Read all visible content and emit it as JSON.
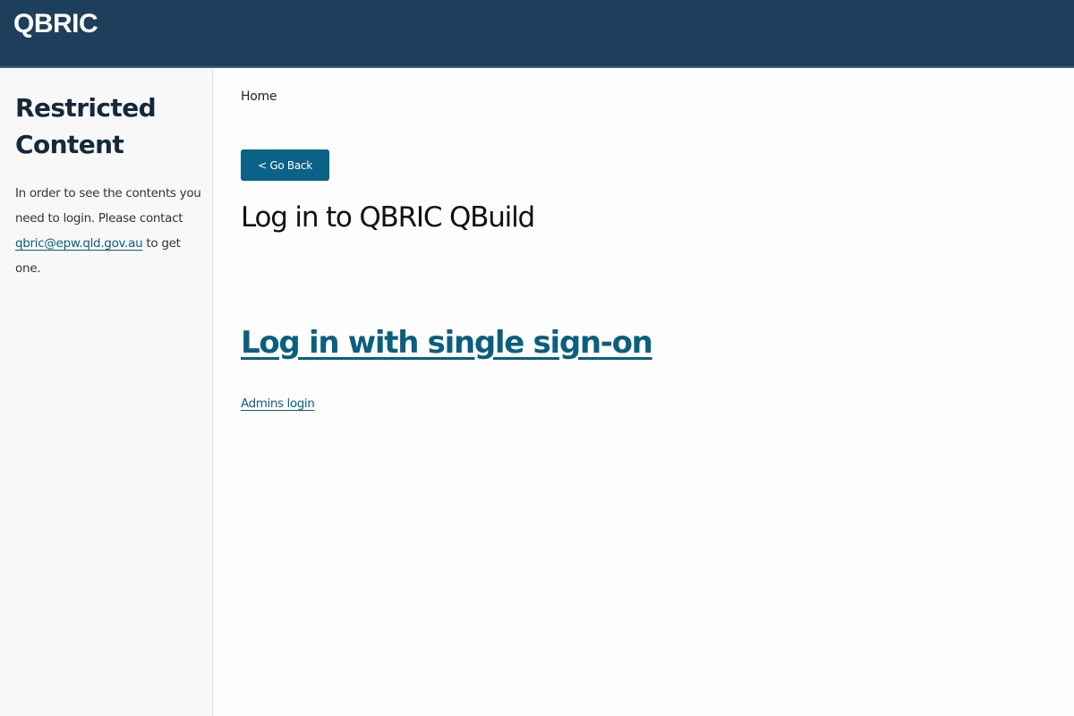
{
  "header": {
    "brand": "QBRIC"
  },
  "sidebar": {
    "title": "Restricted Content",
    "text_before": "In order to see the contents you need to login. Please contact ",
    "email_link": "qbric@epw.qld.gov.au",
    "text_after": " to get one."
  },
  "main": {
    "breadcrumb": "Home",
    "go_back_label": "< Go Back",
    "title": "Log in to QBRIC QBuild",
    "sso_link": "Log in with single sign-on",
    "admin_link": "Admins login"
  },
  "colors": {
    "header_bg": "#1e3f5c",
    "button_bg": "#0a6286",
    "link": "#0b5f7e"
  }
}
